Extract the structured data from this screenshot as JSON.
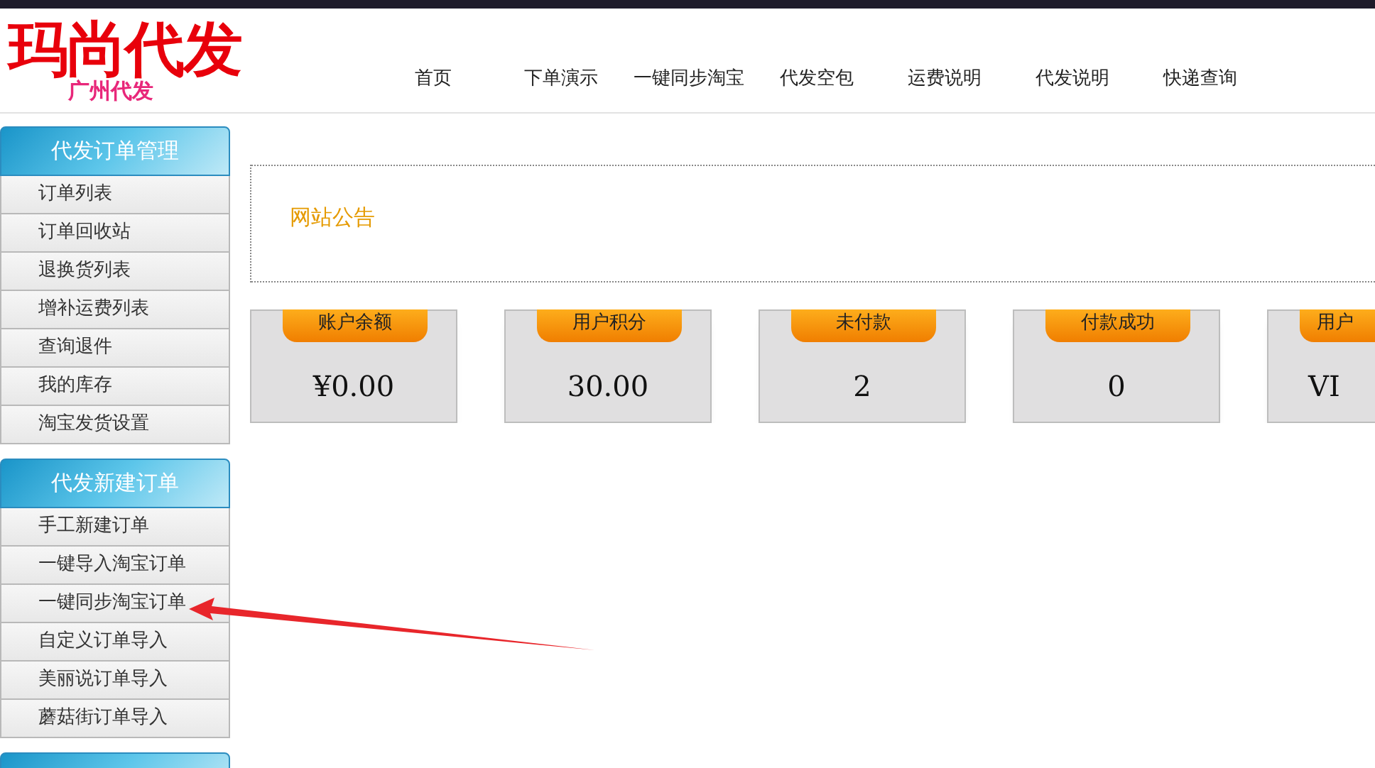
{
  "logo": {
    "title": "玛尚代发",
    "subtitle": "广州代发"
  },
  "nav": [
    "首页",
    "下单演示",
    "一键同步淘宝",
    "代发空包",
    "运费说明",
    "代发说明",
    "快递查询"
  ],
  "sidebar": [
    {
      "title": "代发订单管理",
      "items": [
        "订单列表",
        "订单回收站",
        "退换货列表",
        "增补运费列表",
        "查询退件",
        "我的库存",
        "淘宝发货设置"
      ]
    },
    {
      "title": "代发新建订单",
      "items": [
        "手工新建订单",
        "一键导入淘宝订单",
        "一键同步淘宝订单",
        "自定义订单导入",
        "美丽说订单导入",
        "蘑菇街订单导入"
      ]
    }
  ],
  "notice": {
    "title": "网站公告"
  },
  "stats": [
    {
      "label": "账户余额",
      "value": "¥0.00"
    },
    {
      "label": "用户积分",
      "value": "30.00"
    },
    {
      "label": "未付款",
      "value": "2"
    },
    {
      "label": "付款成功",
      "value": "0"
    },
    {
      "label": "用户",
      "value": "VI"
    }
  ]
}
